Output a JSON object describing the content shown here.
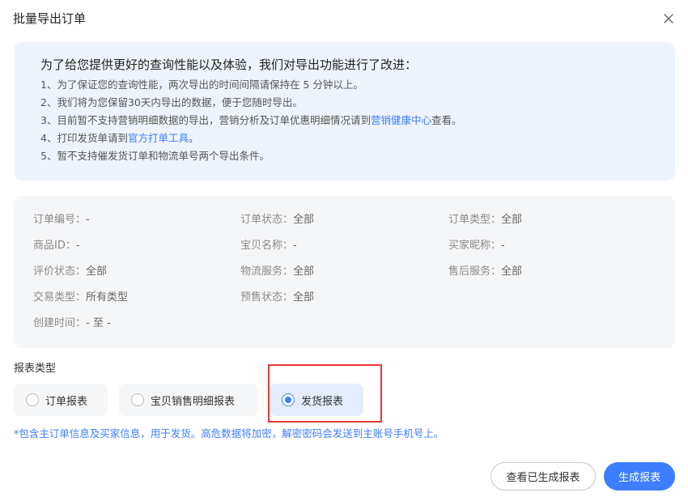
{
  "dialog": {
    "title": "批量导出订单"
  },
  "notice": {
    "heading": "为了给您提供更好的查询性能以及体验，我们对导出功能进行了改进：",
    "items": [
      {
        "text": "1、为了保证您的查询性能，两次导出的时间间隔请保持在 5 分钟以上。"
      },
      {
        "text": "2、我们将为您保留30天内导出的数据，便于您随时导出。"
      },
      {
        "prefix": "3、目前暂不支持营销明细数据的导出，营销分析及订单优惠明细情况请到",
        "link": "营销健康中心",
        "suffix": "查看。"
      },
      {
        "prefix": "4、打印发货单请到",
        "link": "官方打单工具",
        "suffix": "。"
      },
      {
        "text": "5、暂不支持催发货订单和物流单号两个导出条件。"
      }
    ]
  },
  "filters": {
    "order_no": {
      "label": "订单编号：",
      "value": "-"
    },
    "order_status": {
      "label": "订单状态：",
      "value": "全部"
    },
    "order_type": {
      "label": "订单类型：",
      "value": "全部"
    },
    "product_id": {
      "label": "商品ID：",
      "value": "-"
    },
    "product_name": {
      "label": "宝贝名称：",
      "value": "-"
    },
    "buyer_nick": {
      "label": "买家昵称：",
      "value": "-"
    },
    "review_status": {
      "label": "评价状态：",
      "value": "全部"
    },
    "logistics": {
      "label": "物流服务：",
      "value": "全部"
    },
    "after_sale": {
      "label": "售后服务：",
      "value": "全部"
    },
    "trade_type": {
      "label": "交易类型：",
      "value": "所有类型"
    },
    "presale_status": {
      "label": "预售状态：",
      "value": "全部"
    },
    "created_time": {
      "label": "创建时间：",
      "value": "- 至 -"
    }
  },
  "report_type": {
    "label": "报表类型",
    "options": [
      {
        "label": "订单报表",
        "selected": false
      },
      {
        "label": "宝贝销售明细报表",
        "selected": false
      },
      {
        "label": "发货报表",
        "selected": true
      }
    ]
  },
  "hint": "*包含主订单信息及买家信息，用于发货。高危数据将加密，解密密码会发送到主账号手机号上。",
  "footer": {
    "view_generated_label": "查看已生成报表",
    "generate_label": "生成报表"
  },
  "colors": {
    "accent": "#3d7eff",
    "highlight_border": "#e53935",
    "notice_bg": "#eef4fd"
  }
}
